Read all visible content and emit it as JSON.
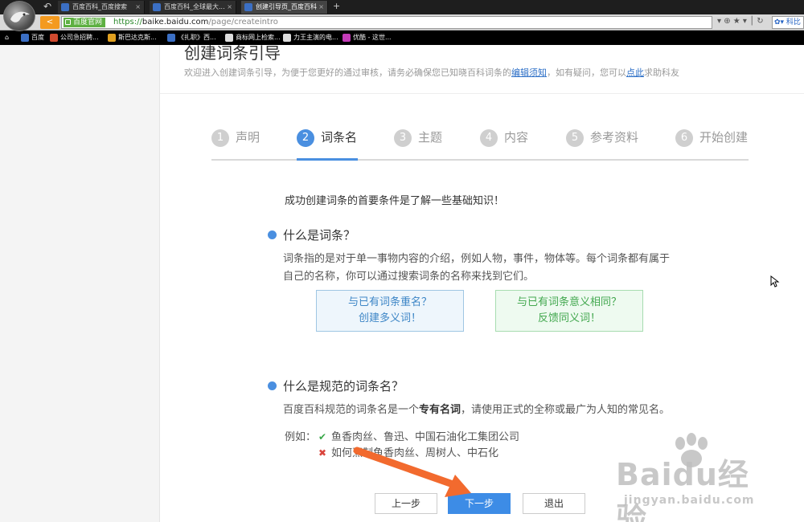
{
  "browser": {
    "tabs": [
      {
        "label": "百度百科_百度搜索",
        "active": false
      },
      {
        "label": "百度百科_全球最大...",
        "active": false
      },
      {
        "label": "创建引导页_百度百科",
        "active": true
      }
    ],
    "new_tab_symbol": "+",
    "back_symbol": "<",
    "site_badge": "百度官网",
    "url_protocol": "https://",
    "url_host": "baike.baidu.com",
    "url_path": "/page/createintro",
    "addr_icons": "▾ ⊕ ★ ▾ │ ↻",
    "search_engine": "✿▾ 科比",
    "bookmarks": [
      {
        "label": "百度",
        "color": "#3b6fc4"
      },
      {
        "label": "公司急招聘...",
        "color": "#d04a2f"
      },
      {
        "label": "斯巴达克斯...",
        "color": "#e0a020"
      },
      {
        "label": "《扎职》西...",
        "color": "#3b6fc4"
      },
      {
        "label": "商标网上检索...",
        "color": "#dddddd"
      },
      {
        "label": "力王主演的电...",
        "color": "#dddddd"
      },
      {
        "label": "优酷 - 这世...",
        "color": "#c43bb8"
      }
    ]
  },
  "page": {
    "title": "创建词条引导",
    "desc_prefix": "欢迎进入创建词条引导，为便于您更好的通过审核，请务必确保您已知晓百科词条的",
    "desc_link1": "编辑须知",
    "desc_middle": "，如有疑问，您可以",
    "desc_link2": "点此",
    "desc_suffix": "求助科友",
    "steps": [
      {
        "num": "1",
        "label": "声明",
        "active": false
      },
      {
        "num": "2",
        "label": "词条名",
        "active": true
      },
      {
        "num": "3",
        "label": "主题",
        "active": false
      },
      {
        "num": "4",
        "label": "内容",
        "active": false
      },
      {
        "num": "5",
        "label": "参考资料",
        "active": false
      },
      {
        "num": "6",
        "label": "开始创建",
        "active": false
      }
    ],
    "intro": "成功创建词条的首要条件是了解一些基础知识！",
    "section1": {
      "title": "什么是词条？",
      "body_line1": "词条指的是对于单一事物内容的介绍，例如人物，事件，物体等。每个词条都有属于",
      "body_line2": "自己的名称，你可以通过搜索词条的名称来找到它们。"
    },
    "option_polysemy": {
      "line1": "与已有词条重名？",
      "line2": "创建多义词！"
    },
    "option_synonym": {
      "line1": "与已有词条意义相同？",
      "line2": "反馈同义词！"
    },
    "section2": {
      "title": "什么是规范的词条名？",
      "body_prefix": "百度百科规范的词条名是一个",
      "body_bold": "专有名词",
      "body_suffix": "，请使用正式的全称或最广为人知的常见名。"
    },
    "example_label": "例如：",
    "example_good": "鱼香肉丝、鲁迅、中国石油化工集团公司",
    "example_bad": "如何烹制鱼香肉丝、周树人、中石化",
    "good_mark": "✔",
    "bad_mark": "✖",
    "buttons": {
      "prev": "上一步",
      "next": "下一步",
      "exit": "退出"
    }
  },
  "watermark": {
    "word": "Baidu经验",
    "url": "jingyan.baidu.com"
  },
  "colors": {
    "accent_blue": "#4a8fe0",
    "annotation_arrow": "#f26a2e",
    "ok_green": "#3aa84a",
    "error_red": "#d9443c"
  }
}
